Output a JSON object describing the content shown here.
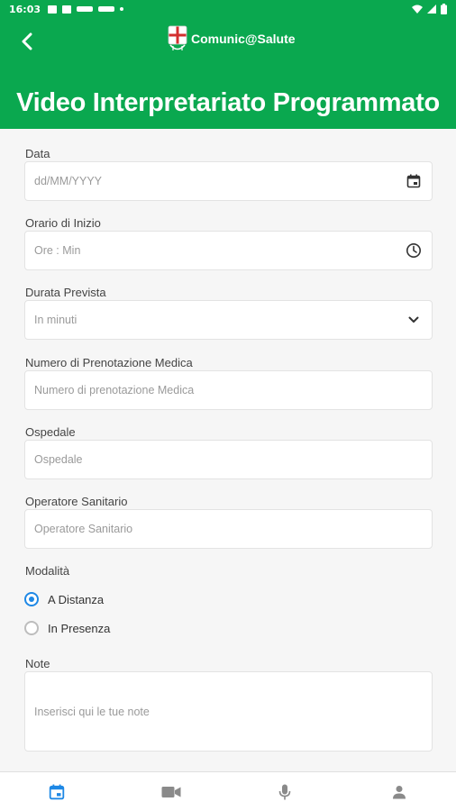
{
  "status_bar": {
    "time": "16:03"
  },
  "header": {
    "app_name": "Comunic@Salute",
    "title": "Video Interpretariato Programmato"
  },
  "form": {
    "data": {
      "label": "Data",
      "placeholder": "dd/MM/YYYY",
      "icon": "calendar-icon"
    },
    "orario": {
      "label": "Orario di Inizio",
      "placeholder": "Ore : Min",
      "icon": "clock-icon"
    },
    "durata": {
      "label": "Durata Prevista",
      "placeholder": "In minuti",
      "icon": "chevron-down-icon"
    },
    "numero": {
      "label": "Numero di Prenotazione Medica",
      "placeholder": "Numero di prenotazione Medica"
    },
    "ospedale": {
      "label": "Ospedale",
      "placeholder": "Ospedale"
    },
    "operatore": {
      "label": "Operatore Sanitario",
      "placeholder": "Operatore Sanitario"
    },
    "modalita": {
      "label": "Modalità",
      "options": [
        {
          "label": "A Distanza",
          "selected": true
        },
        {
          "label": "In Presenza",
          "selected": false
        }
      ]
    },
    "note": {
      "label": "Note",
      "placeholder": "Inserisci qui le tue note"
    }
  },
  "bottom_nav": [
    {
      "icon": "calendar-icon",
      "active": true
    },
    {
      "icon": "video-icon",
      "active": false
    },
    {
      "icon": "microphone-icon",
      "active": false
    },
    {
      "icon": "person-icon",
      "active": false
    }
  ],
  "colors": {
    "primary": "#0aa84f",
    "accent": "#1e88e5",
    "inactive_icon": "#8a8a8a"
  }
}
